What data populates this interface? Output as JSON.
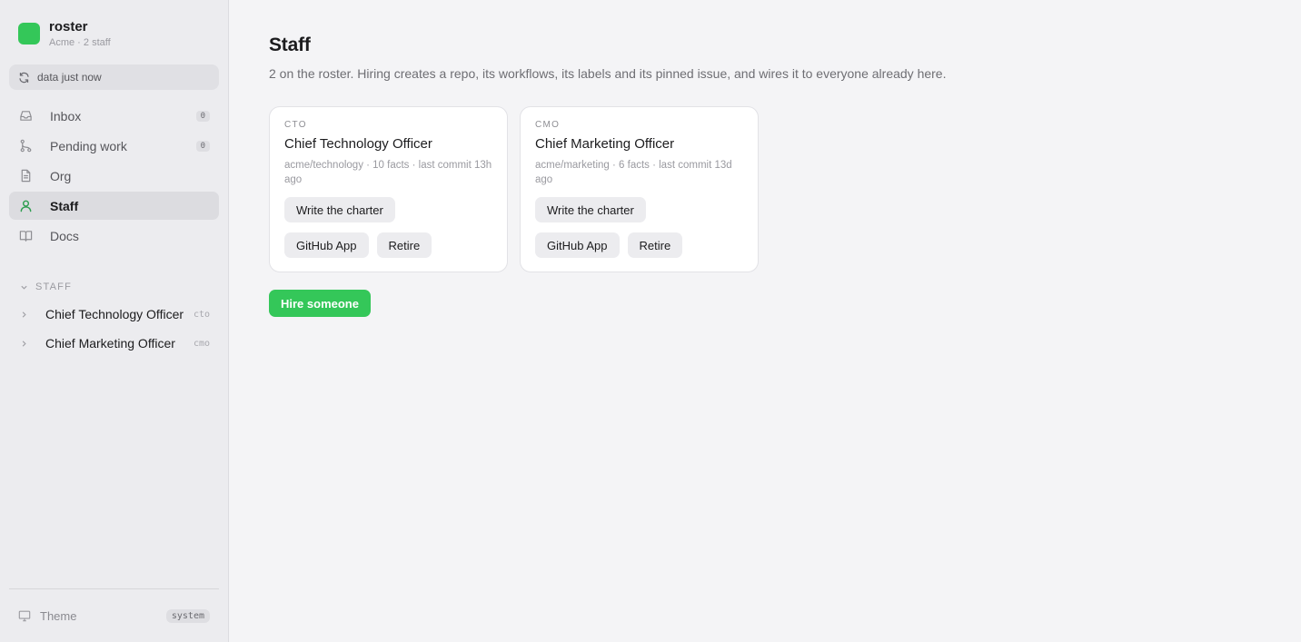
{
  "brand": {
    "name": "roster",
    "subtitle": "Acme · 2 staff",
    "color": "#34c759"
  },
  "refresh": {
    "label": "data just now",
    "icon": "refresh-icon"
  },
  "nav": {
    "items": [
      {
        "label": "Inbox",
        "icon": "inbox-icon",
        "badge": "0",
        "active": false
      },
      {
        "label": "Pending work",
        "icon": "branch-icon",
        "badge": "0",
        "active": false
      },
      {
        "label": "Org",
        "icon": "document-icon",
        "active": false
      },
      {
        "label": "Staff",
        "icon": "person-icon",
        "active": true
      },
      {
        "label": "Docs",
        "icon": "book-icon",
        "active": false
      }
    ]
  },
  "staff_section": {
    "heading": "STAFF",
    "items": [
      {
        "label": "Chief Technology Officer",
        "code": "cto"
      },
      {
        "label": "Chief Marketing Officer",
        "code": "cmo"
      }
    ]
  },
  "footer": {
    "theme_label": "Theme",
    "theme_value": "system"
  },
  "main": {
    "title": "Staff",
    "description": "2 on the roster. Hiring creates a repo, its workflows, its labels and its pinned issue, and wires it to everyone already here.",
    "cards": [
      {
        "code": "CTO",
        "title": "Chief Technology Officer",
        "meta": "acme/technology · 10 facts · last commit 13h ago",
        "charter_label": "Write the charter",
        "github_label": "GitHub App",
        "retire_label": "Retire"
      },
      {
        "code": "CMO",
        "title": "Chief Marketing Officer",
        "meta": "acme/marketing · 6 facts · last commit 13d ago",
        "charter_label": "Write the charter",
        "github_label": "GitHub App",
        "retire_label": "Retire"
      }
    ],
    "hire_label": "Hire someone"
  },
  "colors": {
    "accent": "#34c759",
    "active_nav_icon": "#2e9e4f"
  }
}
